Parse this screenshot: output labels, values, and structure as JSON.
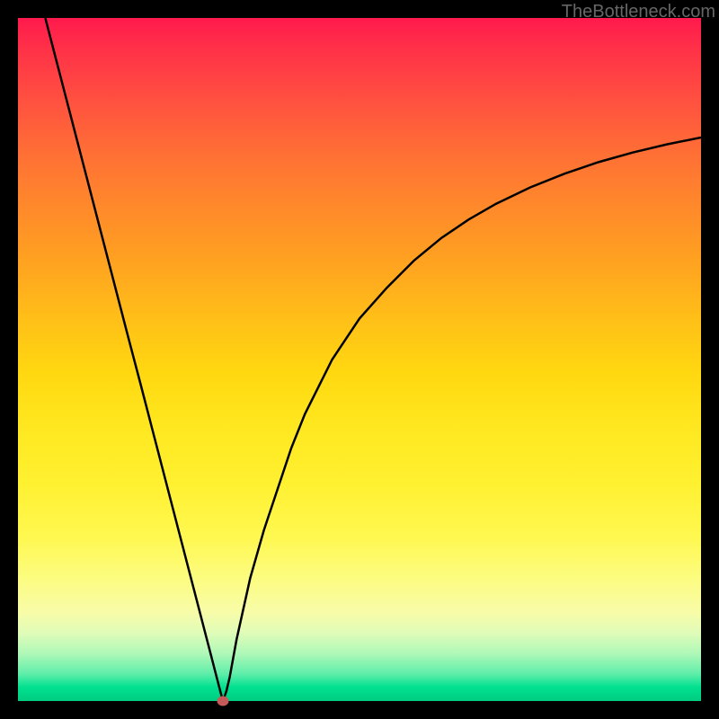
{
  "watermark": "TheBottleneck.com",
  "chart_data": {
    "type": "line",
    "title": "",
    "xlabel": "",
    "ylabel": "",
    "xlim": [
      0,
      100
    ],
    "ylim": [
      0,
      100
    ],
    "series": [
      {
        "name": "curve",
        "x": [
          4,
          6,
          8,
          10,
          12,
          14,
          16,
          18,
          20,
          22,
          24,
          26,
          28,
          29.5,
          30,
          30.5,
          31,
          32,
          34,
          36,
          38,
          40,
          42,
          46,
          50,
          54,
          58,
          62,
          66,
          70,
          75,
          80,
          85,
          90,
          95,
          100
        ],
        "y": [
          100,
          92.3,
          84.6,
          76.9,
          69.2,
          61.5,
          53.8,
          46.2,
          38.5,
          30.8,
          23.1,
          15.4,
          7.7,
          1.9,
          0,
          1.4,
          3.5,
          9,
          18,
          25,
          31,
          37,
          42,
          50,
          56,
          60.5,
          64.5,
          67.8,
          70.5,
          72.8,
          75.2,
          77.2,
          78.9,
          80.3,
          81.5,
          82.5
        ]
      }
    ],
    "marker": {
      "x": 30,
      "y": 0
    },
    "gradient_bands": [
      {
        "color": "#ff1a4d",
        "stop": 0
      },
      {
        "color": "#fff030",
        "stop": 68
      },
      {
        "color": "#00cc80",
        "stop": 100
      }
    ]
  }
}
